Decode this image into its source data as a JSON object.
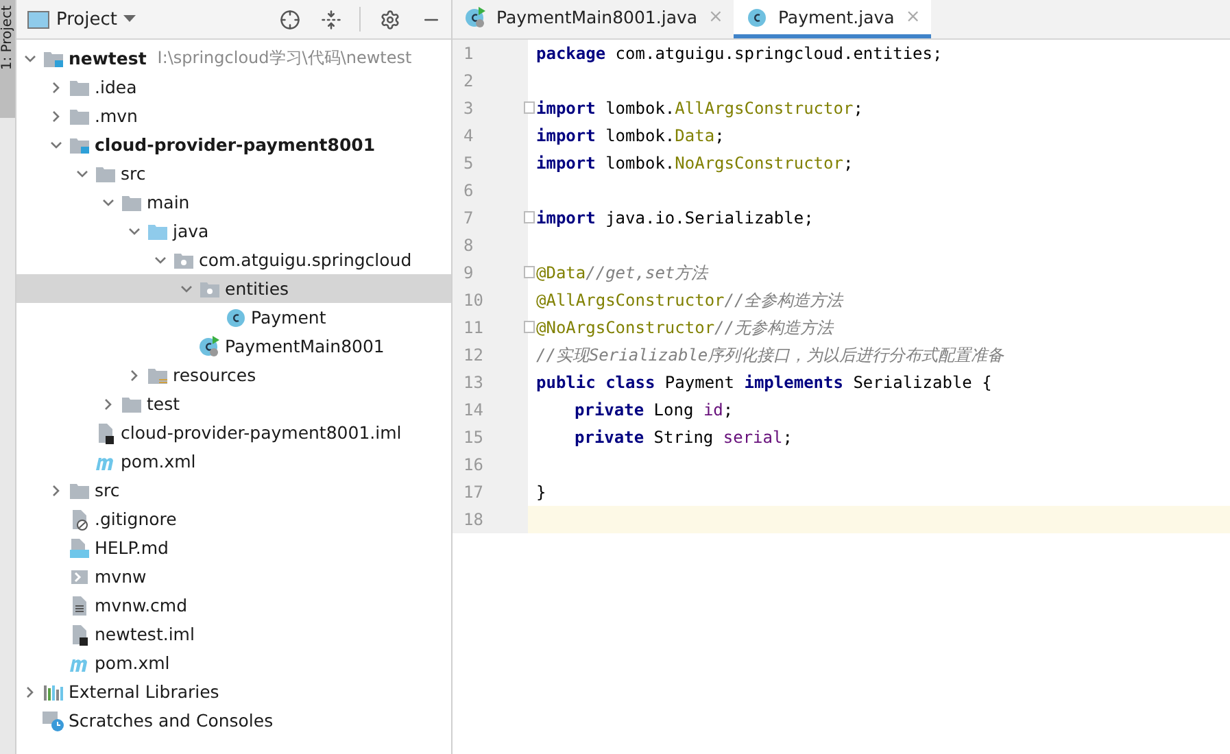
{
  "tool_strip": {
    "label": "1: Project"
  },
  "project_panel": {
    "title": "Project"
  },
  "tree": [
    {
      "label": "newtest",
      "kind": "module",
      "hint": "I:\\springcloud学习\\代码\\newtest",
      "expanded": true,
      "selected": false,
      "children": [
        {
          "label": ".idea",
          "kind": "folder",
          "expanded": false,
          "selected": false
        },
        {
          "label": ".mvn",
          "kind": "folder",
          "expanded": false,
          "selected": false
        },
        {
          "label": "cloud-provider-payment8001",
          "kind": "module",
          "expanded": true,
          "selected": false,
          "children": [
            {
              "label": "src",
              "kind": "folder",
              "expanded": true,
              "selected": false,
              "children": [
                {
                  "label": "main",
                  "kind": "folder",
                  "expanded": true,
                  "selected": false,
                  "children": [
                    {
                      "label": "java",
                      "kind": "source",
                      "expanded": true,
                      "selected": false,
                      "children": [
                        {
                          "label": "com.atguigu.springcloud",
                          "kind": "package",
                          "expanded": true,
                          "selected": false,
                          "children": [
                            {
                              "label": "entities",
                              "kind": "package",
                              "expanded": true,
                              "selected": true,
                              "children": [
                                {
                                  "label": "Payment",
                                  "kind": "class",
                                  "selected": false
                                }
                              ]
                            },
                            {
                              "label": "PaymentMain8001",
                              "kind": "main-class",
                              "selected": false
                            }
                          ]
                        }
                      ]
                    },
                    {
                      "label": "resources",
                      "kind": "resources",
                      "expanded": false,
                      "selected": false
                    }
                  ]
                },
                {
                  "label": "test",
                  "kind": "folder",
                  "expanded": false,
                  "selected": false
                }
              ]
            },
            {
              "label": "cloud-provider-payment8001.iml",
              "kind": "iml",
              "selected": false
            },
            {
              "label": "pom.xml",
              "kind": "maven",
              "selected": false
            }
          ]
        },
        {
          "label": "src",
          "kind": "folder",
          "expanded": false,
          "selected": false
        },
        {
          "label": ".gitignore",
          "kind": "ignore",
          "selected": false
        },
        {
          "label": "HELP.md",
          "kind": "markdown",
          "selected": false
        },
        {
          "label": "mvnw",
          "kind": "script",
          "selected": false
        },
        {
          "label": "mvnw.cmd",
          "kind": "text",
          "selected": false
        },
        {
          "label": "newtest.iml",
          "kind": "iml",
          "selected": false
        },
        {
          "label": "pom.xml",
          "kind": "maven",
          "selected": false
        }
      ]
    },
    {
      "label": "External Libraries",
      "kind": "libraries",
      "expanded": false,
      "selected": false
    },
    {
      "label": "Scratches and Consoles",
      "kind": "scratches",
      "selected": false
    }
  ],
  "tabs": [
    {
      "label": "PaymentMain8001.java",
      "kind": "main-class",
      "selected": false,
      "close": "×"
    },
    {
      "label": "Payment.java",
      "kind": "class",
      "selected": true,
      "close": "×"
    }
  ],
  "code": [
    {
      "number": "1",
      "tokens": [
        {
          "kind": "keyword",
          "text": "package"
        },
        {
          "kind": "plain",
          "text": " com.atguigu.springcloud.entities;"
        }
      ]
    },
    {
      "number": "2"
    },
    {
      "number": "3",
      "fold": true,
      "tokens": [
        {
          "kind": "keyword",
          "text": "import"
        },
        {
          "kind": "plain",
          "text": " lombok."
        },
        {
          "kind": "annotation",
          "text": "AllArgsConstructor"
        },
        {
          "kind": "plain",
          "text": ";"
        }
      ]
    },
    {
      "number": "4",
      "tokens": [
        {
          "kind": "keyword",
          "text": "import"
        },
        {
          "kind": "plain",
          "text": " lombok."
        },
        {
          "kind": "annotation",
          "text": "Data"
        },
        {
          "kind": "plain",
          "text": ";"
        }
      ]
    },
    {
      "number": "5",
      "tokens": [
        {
          "kind": "keyword",
          "text": "import"
        },
        {
          "kind": "plain",
          "text": " lombok."
        },
        {
          "kind": "annotation",
          "text": "NoArgsConstructor"
        },
        {
          "kind": "plain",
          "text": ";"
        }
      ]
    },
    {
      "number": "6"
    },
    {
      "number": "7",
      "fold": true,
      "tokens": [
        {
          "kind": "keyword",
          "text": "import"
        },
        {
          "kind": "plain",
          "text": " java.io.Serializable;"
        }
      ]
    },
    {
      "number": "8"
    },
    {
      "number": "9",
      "fold": true,
      "tokens": [
        {
          "kind": "annotation",
          "text": "@Data"
        },
        {
          "kind": "comment",
          "text": "//get,set方法"
        }
      ]
    },
    {
      "number": "10",
      "tokens": [
        {
          "kind": "annotation",
          "text": "@AllArgsConstructor"
        },
        {
          "kind": "comment",
          "text": "//全参构造方法"
        }
      ]
    },
    {
      "number": "11",
      "fold": true,
      "tokens": [
        {
          "kind": "annotation",
          "text": "@NoArgsConstructor"
        },
        {
          "kind": "comment",
          "text": "//无参构造方法"
        }
      ]
    },
    {
      "number": "12",
      "tokens": [
        {
          "kind": "comment",
          "text": "//实现Serializable序列化接口，为以后进行分布式配置准备"
        }
      ]
    },
    {
      "number": "13",
      "tokens": [
        {
          "kind": "keyword",
          "text": "public class"
        },
        {
          "kind": "plain",
          "text": " Payment "
        },
        {
          "kind": "keyword",
          "text": "implements"
        },
        {
          "kind": "plain",
          "text": " Serializable {"
        }
      ]
    },
    {
      "number": "14",
      "indented": true,
      "tokens": [
        {
          "kind": "keyword",
          "text": "private"
        },
        {
          "kind": "plain",
          "text": " Long "
        },
        {
          "kind": "field",
          "text": "id"
        },
        {
          "kind": "plain",
          "text": ";"
        }
      ]
    },
    {
      "number": "15",
      "indented": true,
      "tokens": [
        {
          "kind": "keyword",
          "text": "private"
        },
        {
          "kind": "plain",
          "text": " String "
        },
        {
          "kind": "field",
          "text": "serial"
        },
        {
          "kind": "plain",
          "text": ";"
        }
      ]
    },
    {
      "number": "16"
    },
    {
      "number": "17",
      "tokens": [
        {
          "kind": "plain",
          "text": "}"
        }
      ]
    },
    {
      "number": "18",
      "current": true
    }
  ]
}
